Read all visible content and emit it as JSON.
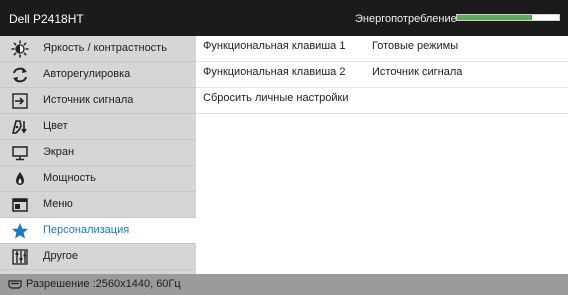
{
  "header": {
    "model": "Dell P2418HT",
    "energy_label": "Энергопотребление",
    "energy_level": 0.74,
    "energy_color": "#5fa85f"
  },
  "sidebar": {
    "items": [
      {
        "label": "Яркость / контрастность",
        "icon": "brightness-icon"
      },
      {
        "label": "Авторегулировка",
        "icon": "auto-adjust-icon"
      },
      {
        "label": "Источник сигнала",
        "icon": "input-source-icon"
      },
      {
        "label": "Цвет",
        "icon": "color-icon"
      },
      {
        "label": "Экран",
        "icon": "display-icon"
      },
      {
        "label": "Мощность",
        "icon": "power-icon"
      },
      {
        "label": "Меню",
        "icon": "menu-icon"
      },
      {
        "label": "Персонализация",
        "icon": "star-icon",
        "active": true
      },
      {
        "label": "Другое",
        "icon": "other-icon"
      }
    ]
  },
  "content": {
    "rows": [
      {
        "key": "Функциональная клавиша 1",
        "value": "Готовые режимы"
      },
      {
        "key": "Функциональная клавиша 2",
        "value": "Источник сигнала"
      },
      {
        "key": "Сбросить личные настройки",
        "value": ""
      }
    ]
  },
  "status": {
    "text": "Разрешение :2560x1440, 60Гц",
    "icon": "display-port-icon"
  },
  "colors": {
    "accent": "#1a78c8",
    "titlebar": "#1b1b1b",
    "sidebar": "#d6d6d6",
    "statusbar": "#9b9b9b"
  }
}
